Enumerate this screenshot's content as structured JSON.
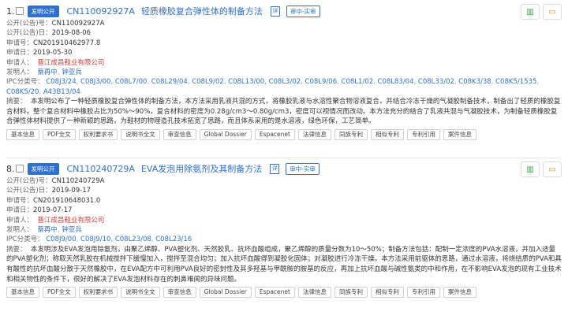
{
  "records": [
    {
      "index": "1.",
      "pub_tag": "发明公开",
      "pub_no": "CN110092927A",
      "title": "轻质橡胶复合弹性体的制备方法",
      "doc_icon_label": "详",
      "status": "审中-实审",
      "fields": [
        {
          "label": "公开(公告)号：",
          "value": "CN110092927A"
        },
        {
          "label": "公开(公告)日：",
          "value": "2019-08-06"
        },
        {
          "label": "申请号：",
          "value": "CN201910462977.8"
        },
        {
          "label": "申请日：",
          "value": "2019-05-30"
        }
      ],
      "applicant_label": "申请人：",
      "applicant": "晋江成昌鞋业有限公司",
      "inventor_label": "发明人：",
      "inventors": [
        "蔡再中",
        "钟亚兵"
      ],
      "ipc_label": "IPC分类号：",
      "ipc": [
        "C08J3/24",
        "C08J3/00",
        "C08L7/00",
        "C08L29/04",
        "C08L9/02",
        "C08L13/00",
        "C08L3/02",
        "C08L9/06",
        "C08L1/02",
        "C08L83/04",
        "C08L33/02",
        "C08K3/38",
        "C08K5/1535",
        "C08K5/20",
        "A43B13/04"
      ],
      "abstract_label": "摘要：",
      "abstract": "本发明公布了一种轻质橡胶复合弹性体的制备方法，本方法采用乳液共混的方式，将橡胶乳液与水溶性聚合物溶液复合，并结合冷冻干燥的气凝胶制备技术，制备出了轻质的橡胶复合材料。整个复合材料中橡胶占比为50%～90%，复合材料的密度为0.28g/cm3～0.80g/cm3，密度可以视情况而改动。本方法充分的结合了乳液共混与气凝胶技术，为制备轻质橡胶复合弹性体材料提供了一种新颖的思路，为鞋材的物理造孔技术拓宽了思路，而且体系采用的是水溶液，绿色环保，工艺简单。",
      "buttons": [
        "基本信息",
        "PDF全文",
        "权利要求书",
        "说明书全文",
        "审查信息",
        "Global Dossier",
        "Espacenet",
        "法律信息",
        "同族专利",
        "相似专利",
        "专利引用",
        "案件信息"
      ]
    },
    {
      "index": "8.",
      "pub_tag": "发明公开",
      "pub_no": "CN110240729A",
      "title": "EVA发泡用除氨剂及其制备方法",
      "doc_icon_label": "详",
      "status": "审中-实审",
      "fields": [
        {
          "label": "公开(公告)号：",
          "value": "CN110240729A"
        },
        {
          "label": "公开(公告)日：",
          "value": "2019-09-17"
        },
        {
          "label": "申请号：",
          "value": "CN201910648031.0"
        },
        {
          "label": "申请日：",
          "value": "2019-07-17"
        }
      ],
      "applicant_label": "申请人：",
      "applicant": "晋江成昌鞋业有限公司",
      "inventor_label": "发明人：",
      "inventors": [
        "蔡再中",
        "钟亚兵"
      ],
      "ipc_label": "IPC分类号：",
      "ipc": [
        "C08J9/00",
        "C08J9/10",
        "C08L23/08",
        "C08L23/16"
      ],
      "abstract_label": "摘要：",
      "abstract": "本发明涉及EVA发泡用除氨剂，由聚乙烯醇、PVA塑化剂、天然胶乳、抗坏血酸组成，聚乙烯醇的质量分数为10～50%；制备方法包括：配制一定浓度的PVA水溶液，并加入适量的PVA塑化剂；称取天然乳胶在机械搅拌下缓慢加入，搅拌至混合均匀；加入抗坏血酸得到凝胶化固体；对凝胶进行冷冻干燥。本方法采用前驱体的思路，通过水溶液，将烧结质的PVA和具有酸性的抗坏血酸分散于天然橡胶中，在EVA配方中可利用PVA良好的密封性及其多羟基与甲酰胺的胺基的反应，再加上抗坏血酸与碱性氨类的中和作用，在不影响EVA发泡的现有工业技术和相关物性的条件下，很好的解决了EVA发泡材料存在的刺鼻难闻的异味问题。",
      "buttons": [
        "基本信息",
        "PDF全文",
        "权利要求书",
        "说明书全文",
        "审查信息",
        "Global Dossier",
        "Espacenet",
        "法律信息",
        "同族专利",
        "相似专利",
        "专利引用",
        "案件信息"
      ]
    }
  ],
  "icons": {
    "action_1": "open-book-icon",
    "action_2": "folder-icon"
  }
}
